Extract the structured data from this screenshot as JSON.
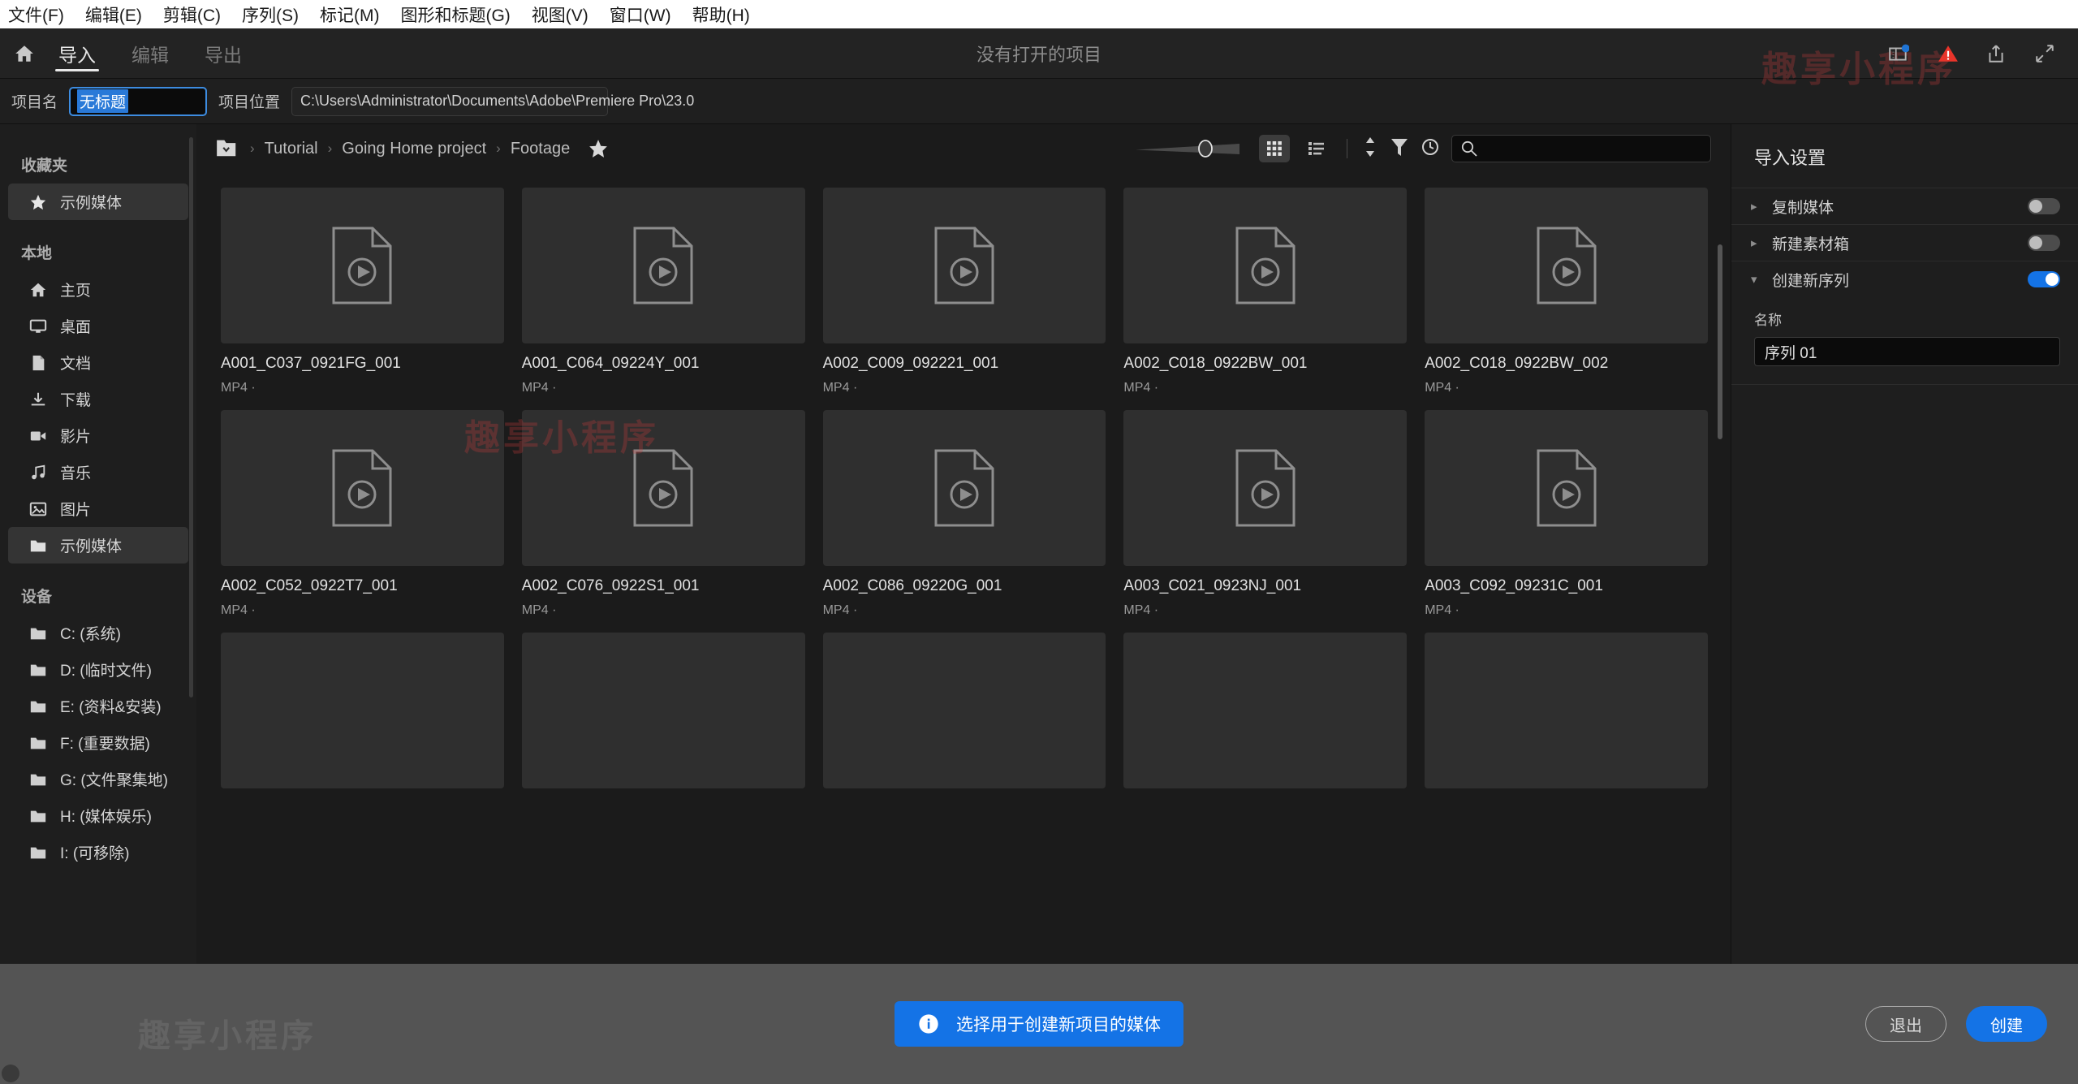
{
  "menubar": {
    "items": [
      "文件(F)",
      "编辑(E)",
      "剪辑(C)",
      "序列(S)",
      "标记(M)",
      "图形和标题(G)",
      "视图(V)",
      "窗口(W)",
      "帮助(H)"
    ]
  },
  "header": {
    "title": "没有打开的项目",
    "tabs": [
      {
        "label": "导入",
        "active": true
      },
      {
        "label": "编辑",
        "active": false
      },
      {
        "label": "导出",
        "active": false
      }
    ],
    "icons": [
      "home-icon",
      "notifications-icon",
      "warning-icon",
      "share-icon",
      "fullscreen-icon"
    ]
  },
  "project": {
    "name_label": "项目名",
    "name_value": "无标题",
    "location_label": "项目位置",
    "location_value": "C:\\Users\\Administrator\\Documents\\Adobe\\Premiere Pro\\23.0"
  },
  "sidebar": {
    "sections": [
      {
        "title": "收藏夹",
        "items": [
          {
            "label": "示例媒体",
            "icon": "star-icon",
            "selected": true
          }
        ]
      },
      {
        "title": "本地",
        "items": [
          {
            "label": "主页",
            "icon": "home-icon",
            "selected": false
          },
          {
            "label": "桌面",
            "icon": "monitor-icon",
            "selected": false
          },
          {
            "label": "文档",
            "icon": "document-icon",
            "selected": false
          },
          {
            "label": "下载",
            "icon": "download-icon",
            "selected": false
          },
          {
            "label": "影片",
            "icon": "video-camera-icon",
            "selected": false
          },
          {
            "label": "音乐",
            "icon": "music-note-icon",
            "selected": false
          },
          {
            "label": "图片",
            "icon": "image-icon",
            "selected": false
          },
          {
            "label": "示例媒体",
            "icon": "folder-icon",
            "selected": true
          }
        ]
      },
      {
        "title": "设备",
        "items": [
          {
            "label": "C: (系统)",
            "icon": "folder-icon",
            "selected": false
          },
          {
            "label": "D: (临时文件)",
            "icon": "folder-icon",
            "selected": false
          },
          {
            "label": "E: (资料&安装)",
            "icon": "folder-icon",
            "selected": false
          },
          {
            "label": "F: (重要数据)",
            "icon": "folder-icon",
            "selected": false
          },
          {
            "label": "G: (文件聚集地)",
            "icon": "folder-icon",
            "selected": false
          },
          {
            "label": "H: (媒体娱乐)",
            "icon": "folder-icon",
            "selected": false
          },
          {
            "label": "I: (可移除)",
            "icon": "folder-icon",
            "selected": false
          }
        ]
      }
    ]
  },
  "breadcrumb": {
    "items": [
      "Tutorial",
      "Going Home project",
      "Footage"
    ],
    "separator": "›",
    "folder_icon": "folder-dropdown-icon",
    "star_icon": "star-icon"
  },
  "toolbar": {
    "zoom_slider": "thumbnail-size-slider",
    "grid_view": "grid-view-icon",
    "list_view": "list-view-icon",
    "sort": "sort-icon",
    "filter": "filter-icon",
    "visibility": "eye-icon",
    "search_placeholder": "",
    "search_value": ""
  },
  "media": {
    "meta_suffix": "MP4 ·",
    "items": [
      {
        "name": "A001_C037_0921FG_001",
        "meta": "MP4 ·"
      },
      {
        "name": "A001_C064_09224Y_001",
        "meta": "MP4 ·"
      },
      {
        "name": "A002_C009_092221_001",
        "meta": "MP4 ·"
      },
      {
        "name": "A002_C018_0922BW_001",
        "meta": "MP4 ·"
      },
      {
        "name": "A002_C018_0922BW_002",
        "meta": "MP4 ·"
      },
      {
        "name": "A002_C052_0922T7_001",
        "meta": "MP4 ·"
      },
      {
        "name": "A002_C076_0922S1_001",
        "meta": "MP4 ·"
      },
      {
        "name": "A002_C086_09220G_001",
        "meta": "MP4 ·"
      },
      {
        "name": "A003_C021_0923NJ_001",
        "meta": "MP4 ·"
      },
      {
        "name": "A003_C092_09231C_001",
        "meta": "MP4 ·"
      }
    ]
  },
  "import_settings": {
    "title": "导入设置",
    "rows": [
      {
        "label": "复制媒体",
        "on": false,
        "expanded": false
      },
      {
        "label": "新建素材箱",
        "on": false,
        "expanded": false
      },
      {
        "label": "创建新序列",
        "on": true,
        "expanded": true
      }
    ],
    "sequence_name_label": "名称",
    "sequence_name_value": "序列 01"
  },
  "footer": {
    "banner_text": "选择用于创建新项目的媒体",
    "banner_icon": "info-icon",
    "exit_label": "退出",
    "create_label": "创建"
  },
  "watermarks": {
    "red_center": "趣享小程序",
    "red_top": "趣享小程序",
    "grey_bottom": "趣享小程序"
  },
  "colors": {
    "accent": "#1473e6",
    "selection": "#2979d8",
    "warning": "#e8342a",
    "footer_bg": "#545454"
  }
}
